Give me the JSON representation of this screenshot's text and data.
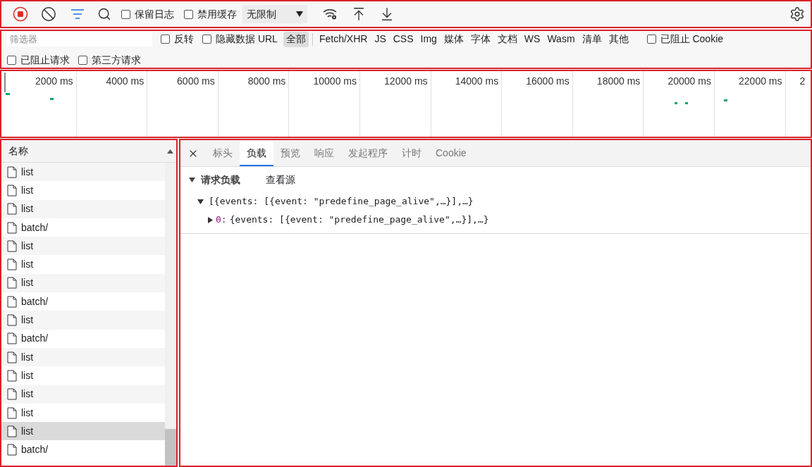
{
  "toolbar": {
    "recording": true,
    "filter_active": true,
    "checkboxes": [
      {
        "label": "保留日志",
        "checked": false
      },
      {
        "label": "禁用缓存",
        "checked": false
      }
    ],
    "throttle": "无限制"
  },
  "filter_bar": {
    "placeholder": "筛选器",
    "options": [
      {
        "label": "反转",
        "checked": false
      },
      {
        "label": "隐藏数据 URL",
        "checked": false
      }
    ],
    "types": [
      {
        "label": "全部",
        "selected": true
      },
      {
        "label": "Fetch/XHR",
        "selected": false
      },
      {
        "label": "JS",
        "selected": false
      },
      {
        "label": "CSS",
        "selected": false
      },
      {
        "label": "Img",
        "selected": false
      },
      {
        "label": "媒体",
        "selected": false
      },
      {
        "label": "字体",
        "selected": false
      },
      {
        "label": "文档",
        "selected": false
      },
      {
        "label": "WS",
        "selected": false
      },
      {
        "label": "Wasm",
        "selected": false
      },
      {
        "label": "清单",
        "selected": false
      },
      {
        "label": "其他",
        "selected": false
      }
    ],
    "blocked_cookies": {
      "label": "已阻止 Cookie",
      "checked": false
    },
    "more_options": [
      {
        "label": "已阻止请求",
        "checked": false
      },
      {
        "label": "第三方请求",
        "checked": false
      }
    ]
  },
  "timeline": {
    "ticks": [
      "2000 ms",
      "4000 ms",
      "6000 ms",
      "8000 ms",
      "10000 ms",
      "12000 ms",
      "14000 ms",
      "16000 ms",
      "18000 ms",
      "20000 ms",
      "22000 ms",
      "2"
    ]
  },
  "requests": {
    "header": "名称",
    "rows": [
      {
        "name": "list",
        "selected": false
      },
      {
        "name": "list",
        "selected": false
      },
      {
        "name": "list",
        "selected": false
      },
      {
        "name": "batch/",
        "selected": false
      },
      {
        "name": "list",
        "selected": false
      },
      {
        "name": "list",
        "selected": false
      },
      {
        "name": "list",
        "selected": false
      },
      {
        "name": "batch/",
        "selected": false
      },
      {
        "name": "list",
        "selected": false
      },
      {
        "name": "batch/",
        "selected": false
      },
      {
        "name": "list",
        "selected": false
      },
      {
        "name": "list",
        "selected": false
      },
      {
        "name": "list",
        "selected": false
      },
      {
        "name": "list",
        "selected": false
      },
      {
        "name": "list",
        "selected": true
      },
      {
        "name": "batch/",
        "selected": false
      }
    ]
  },
  "details": {
    "tabs": [
      {
        "label": "标头",
        "selected": false
      },
      {
        "label": "负载",
        "selected": true
      },
      {
        "label": "预览",
        "selected": false
      },
      {
        "label": "响应",
        "selected": false
      },
      {
        "label": "发起程序",
        "selected": false
      },
      {
        "label": "计时",
        "selected": false
      },
      {
        "label": "Cookie",
        "selected": false
      }
    ],
    "section": {
      "title": "请求负载",
      "expanded": true,
      "link": "查看源"
    },
    "tree": [
      {
        "value": "[{events: [{event: \"predefine_page_alive\",…}],…}",
        "expanded": true,
        "children": [
          {
            "key": "0:",
            "value": "{events: [{event: \"predefine_page_alive\",…}],…}",
            "expanded": false
          }
        ]
      }
    ]
  }
}
